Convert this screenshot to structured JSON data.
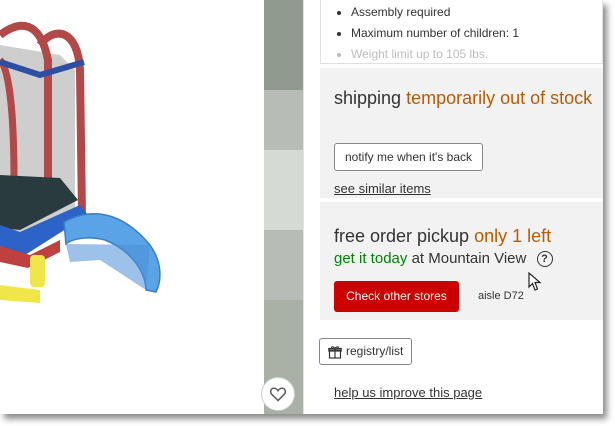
{
  "specs": {
    "items": [
      "Assembly required",
      "Maximum number of children: 1",
      "Weight limit up to 105 lbs."
    ]
  },
  "shipping": {
    "label": "shipping",
    "status": "temporarily out of stock",
    "notify_button": "notify me when it's back",
    "similar_link": "see similar items"
  },
  "pickup": {
    "label": "free order pickup",
    "stock": "only 1 left",
    "today": "get it today",
    "location": "at Mountain View",
    "help_icon": "?",
    "check_button": "Check other stores",
    "aisle": "aisle D72"
  },
  "registry_button": "registry/list",
  "improve_link": "help us improve this page",
  "icons": {
    "favorite": "heart-icon",
    "registry": "gift-icon",
    "help": "question-circle-icon",
    "cursor": "mouse-pointer-icon"
  },
  "colors": {
    "out_of_stock": "#b85b00",
    "in_stock": "#008300",
    "primary_button": "#cc0000",
    "panel_bg": "#f2f2f2"
  }
}
